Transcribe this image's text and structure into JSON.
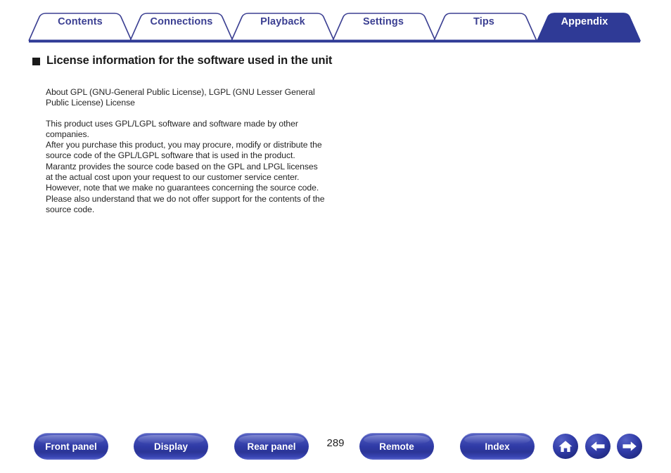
{
  "tabs": {
    "items": [
      {
        "label": "Contents",
        "active": false
      },
      {
        "label": "Connections",
        "active": false
      },
      {
        "label": "Playback",
        "active": false
      },
      {
        "label": "Settings",
        "active": false
      },
      {
        "label": "Tips",
        "active": false
      },
      {
        "label": "Appendix",
        "active": true
      }
    ],
    "active_label": "Appendix",
    "inactive_text_color": "#3b3f92",
    "active_fill_color": "#2f3a96",
    "border_color": "#3b3f92",
    "underline_color": "#2f3a96"
  },
  "heading": {
    "bullet": "square-bullet",
    "text": "License information for the software used in the unit"
  },
  "body": {
    "paragraphs": [
      "About GPL (GNU-General Public License), LGPL (GNU Lesser General Public License) License",
      "This product uses GPL/LGPL software and software made by other companies.",
      "After you purchase this product, you may procure, modify or distribute the source code of the GPL/LGPL software that is used in the product. Marantz provides the source code based on the GPL and LPGL licenses at the actual cost upon your request to our customer service center.",
      "However, note that we make no guarantees concerning the source code.",
      "Please also understand that we do not offer support for the contents of the source code."
    ]
  },
  "footer": {
    "buttons": [
      {
        "label": "Front panel"
      },
      {
        "label": "Display"
      },
      {
        "label": "Rear panel"
      },
      {
        "label": "Remote"
      },
      {
        "label": "Index"
      }
    ],
    "page_number": "289",
    "icons": [
      {
        "name": "home-icon"
      },
      {
        "name": "arrow-left-icon"
      },
      {
        "name": "arrow-right-icon"
      }
    ],
    "button_color": "#2f3aa5"
  }
}
